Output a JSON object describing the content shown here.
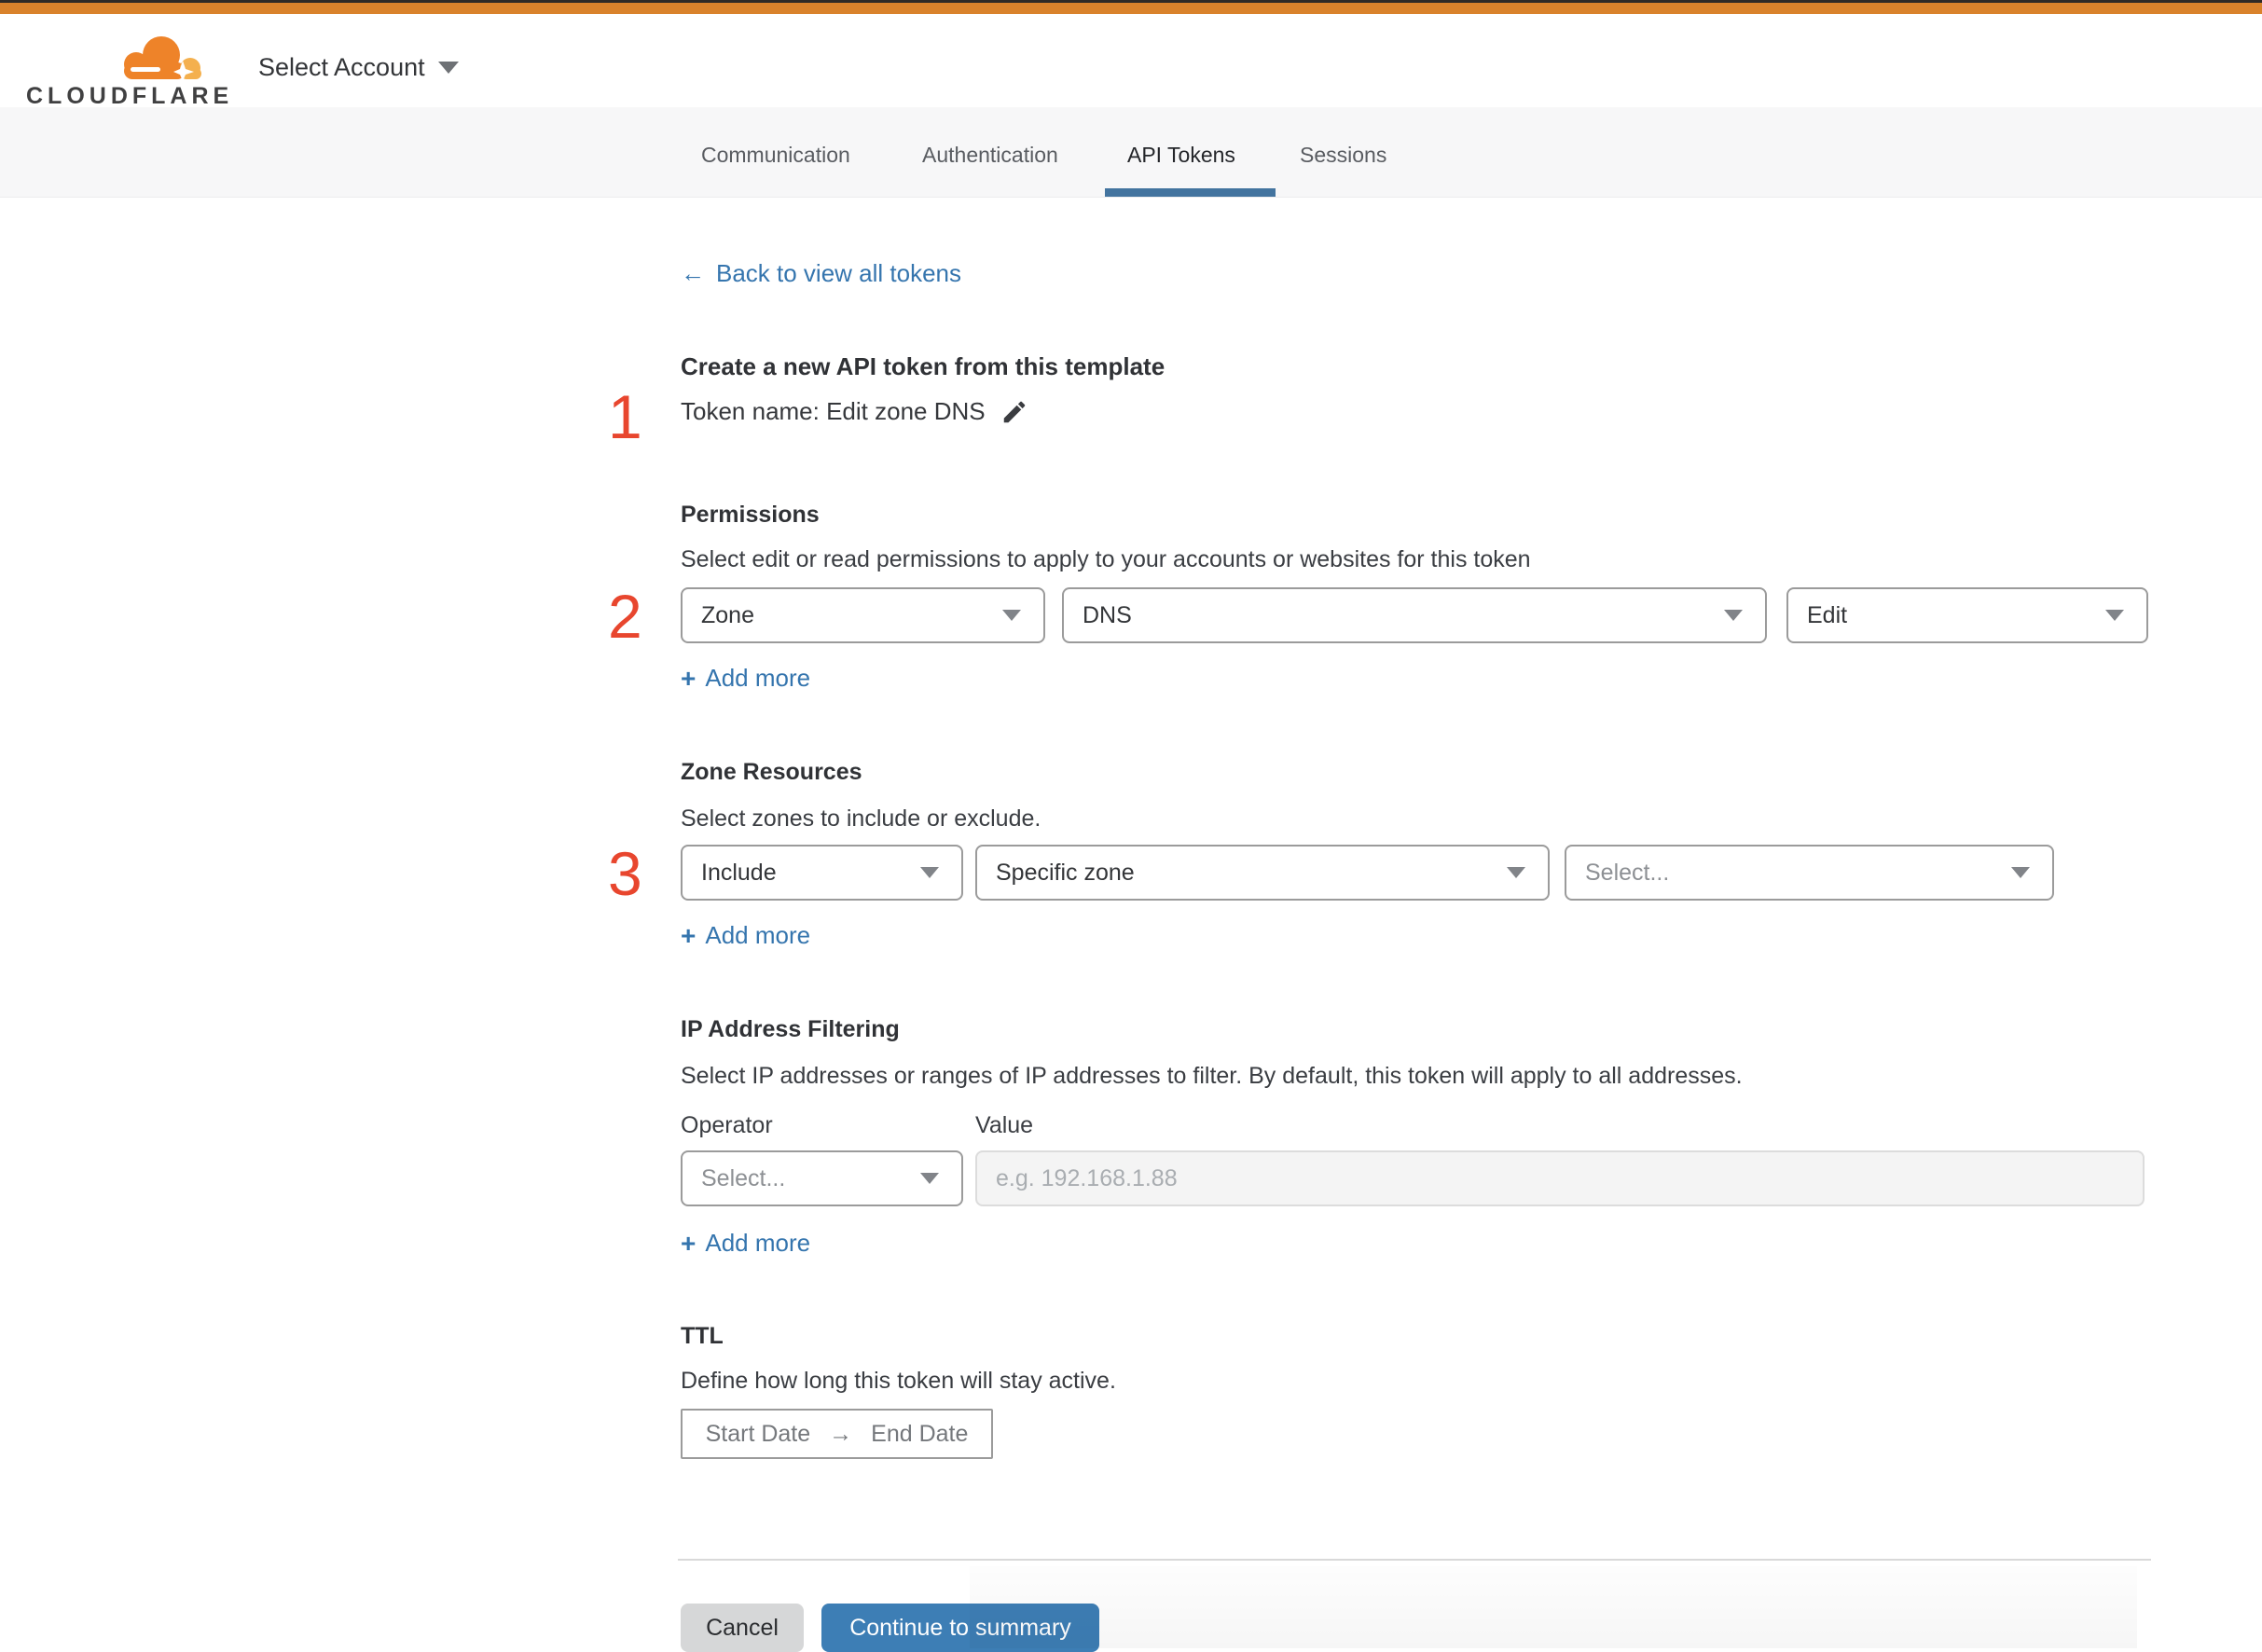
{
  "header": {
    "logo_text": "CLOUDFLARE",
    "account_selector_label": "Select Account"
  },
  "tabs": {
    "items": [
      {
        "label": "Communication",
        "active": false
      },
      {
        "label": "Authentication",
        "active": false
      },
      {
        "label": "API Tokens",
        "active": true
      },
      {
        "label": "Sessions",
        "active": false
      }
    ]
  },
  "back_link": {
    "label": "Back to view all tokens"
  },
  "token": {
    "step_number": "1",
    "heading": "Create a new API token from this template",
    "name_label": "Token name: Edit zone DNS"
  },
  "permissions": {
    "step_number": "2",
    "heading": "Permissions",
    "description": "Select edit or read permissions to apply to your accounts or websites for this token",
    "selects": [
      {
        "value": "Zone"
      },
      {
        "value": "DNS"
      },
      {
        "value": "Edit"
      }
    ],
    "add_more_label": "Add more"
  },
  "zone_resources": {
    "step_number": "3",
    "heading": "Zone Resources",
    "description": "Select zones to include or exclude.",
    "selects": [
      {
        "value": "Include"
      },
      {
        "value": "Specific zone"
      },
      {
        "value": "Select..."
      }
    ],
    "add_more_label": "Add more"
  },
  "ip_filtering": {
    "heading": "IP Address Filtering",
    "description": "Select IP addresses or ranges of IP addresses to filter. By default, this token will apply to all addresses.",
    "operator_label": "Operator",
    "value_label": "Value",
    "operator_value": "Select...",
    "value_placeholder": "e.g. 192.168.1.88",
    "add_more_label": "Add more"
  },
  "ttl": {
    "heading": "TTL",
    "description": "Define how long this token will stay active.",
    "start_label": "Start Date",
    "end_label": "End Date"
  },
  "footer": {
    "cancel_label": "Cancel",
    "continue_label": "Continue to summary"
  },
  "icons": {
    "back_arrow": "←",
    "plus": "+",
    "arrow_right": "→"
  },
  "colors": {
    "top_bar_orange": "#d9822b",
    "accent_blue": "#3d7eb5",
    "link_blue": "#3575ae",
    "step_red": "#e8462e",
    "tab_underline": "#43749f"
  }
}
